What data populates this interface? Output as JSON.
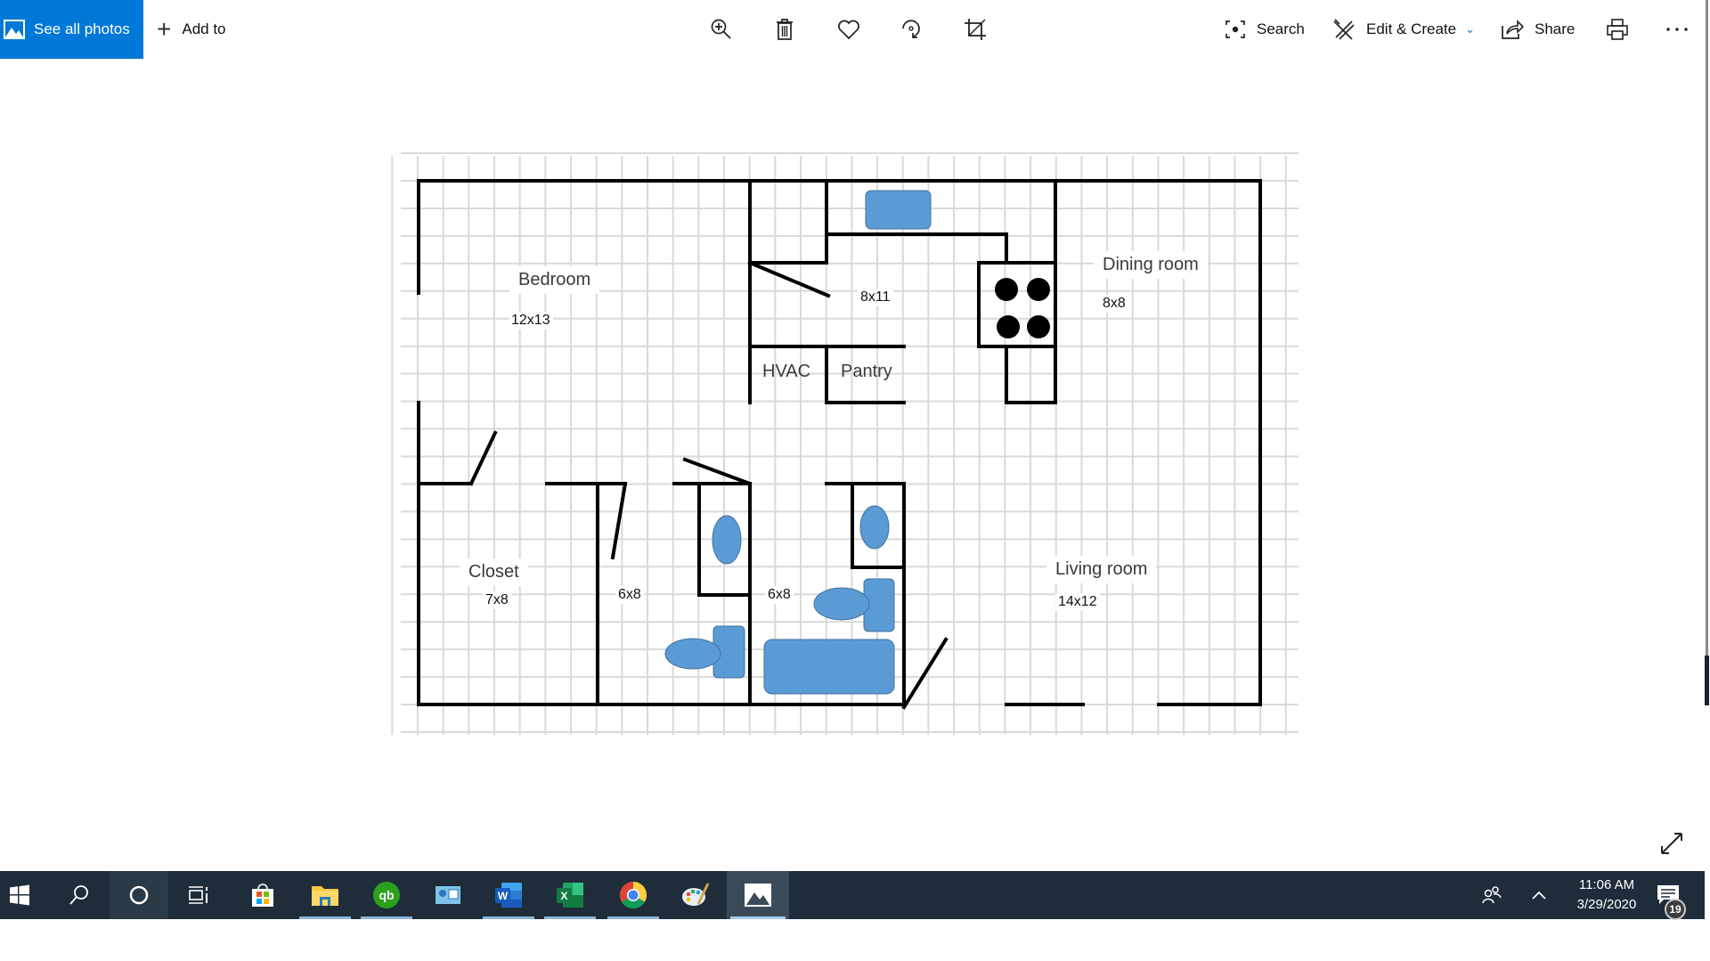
{
  "toolbar": {
    "see_all_photos": "See all photos",
    "add_to": "Add to",
    "icons": [
      "zoom-in-icon",
      "delete-icon",
      "favorite-icon",
      "rotate-icon",
      "crop-icon"
    ],
    "search": "Search",
    "edit_create": "Edit & Create",
    "share": "Share",
    "print_icon": "print-icon",
    "more_icon": "more-icon"
  },
  "floorplan": {
    "wall_color": "#000000",
    "fixture_color": "#5b9bd5",
    "grid_color": "#d9d9d9",
    "rooms": [
      {
        "name": "Bedroom",
        "size": "12x13"
      },
      {
        "name": "",
        "size": "8x11"
      },
      {
        "name": "Dining room",
        "size": "8x8"
      },
      {
        "name": "HVAC",
        "size": ""
      },
      {
        "name": "Pantry",
        "size": ""
      },
      {
        "name": "Closet",
        "size": "7x8"
      },
      {
        "name": "",
        "size": "6x8"
      },
      {
        "name": "",
        "size": "6x8"
      },
      {
        "name": "Living room",
        "size": "14x12"
      }
    ]
  },
  "taskbar": {
    "apps": [
      "start",
      "search",
      "cortana",
      "task-view",
      "microsoft-store",
      "file-explorer",
      "quickbooks",
      "outlook-contacts",
      "word",
      "excel",
      "chrome",
      "paint",
      "photos"
    ],
    "time": "11:06 AM",
    "date": "3/29/2020",
    "notification_count": "19"
  },
  "accent_color": "#0078d7"
}
